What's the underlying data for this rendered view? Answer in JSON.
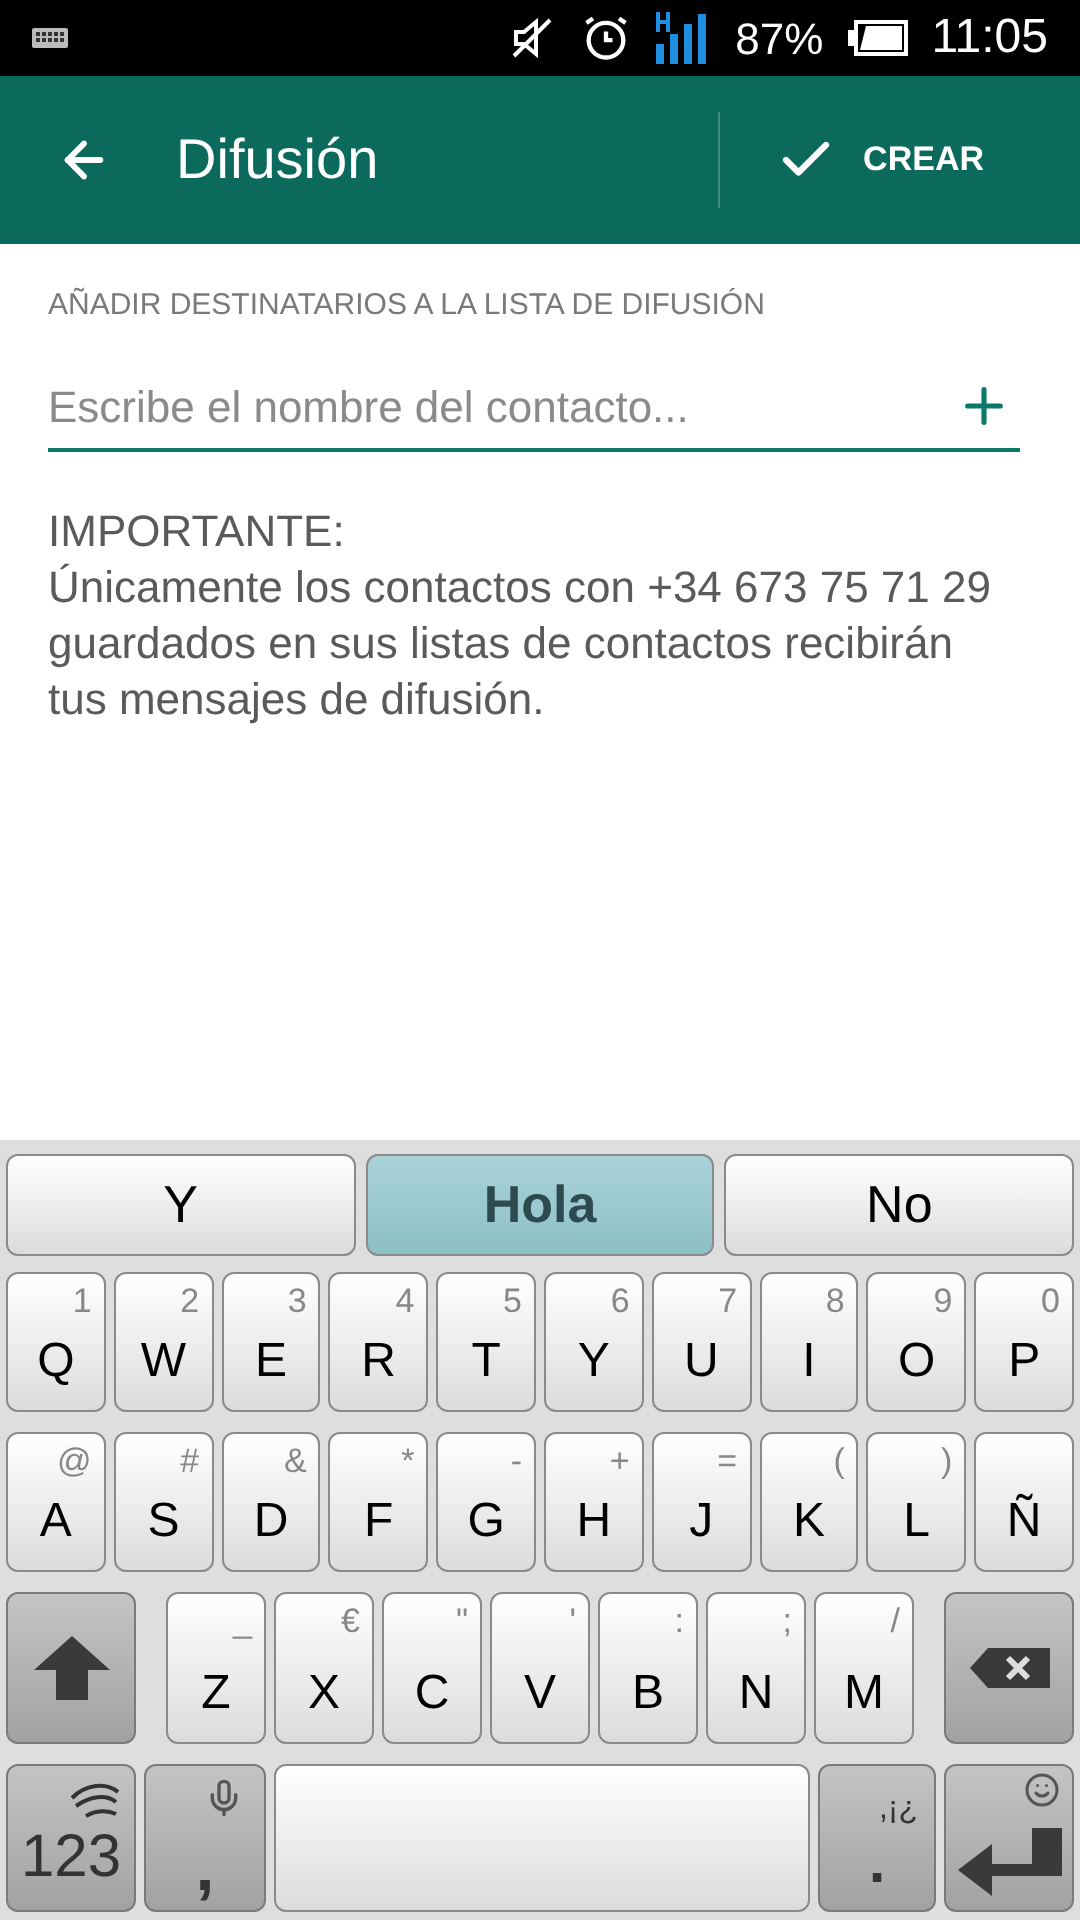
{
  "status_bar": {
    "battery": "87%",
    "time": "11:05"
  },
  "app_bar": {
    "title": "Difusión",
    "action": "CREAR"
  },
  "section_label": "AÑADIR DESTINATARIOS A LA LISTA DE DIFUSIÓN",
  "recipient_field": {
    "placeholder": "Escribe el nombre del contacto..."
  },
  "note": {
    "heading": "IMPORTANTE:",
    "body": "Únicamente los contactos con +34 673 75 71 29 guardados en sus listas de contactos recibirán tus mensajes de difusión."
  },
  "keyboard": {
    "suggestions": [
      {
        "label": "Y",
        "selected": false
      },
      {
        "label": "Hola",
        "selected": true
      },
      {
        "label": "No",
        "selected": false
      }
    ],
    "rows": [
      [
        {
          "kind": "letter",
          "main": "Q",
          "alt": "1"
        },
        {
          "kind": "letter",
          "main": "W",
          "alt": "2"
        },
        {
          "kind": "letter",
          "main": "E",
          "alt": "3"
        },
        {
          "kind": "letter",
          "main": "R",
          "alt": "4"
        },
        {
          "kind": "letter",
          "main": "T",
          "alt": "5"
        },
        {
          "kind": "letter",
          "main": "Y",
          "alt": "6"
        },
        {
          "kind": "letter",
          "main": "U",
          "alt": "7"
        },
        {
          "kind": "letter",
          "main": "I",
          "alt": "8"
        },
        {
          "kind": "letter",
          "main": "O",
          "alt": "9"
        },
        {
          "kind": "letter",
          "main": "P",
          "alt": "0"
        }
      ],
      [
        {
          "kind": "letter",
          "main": "A",
          "alt": "@"
        },
        {
          "kind": "letter",
          "main": "S",
          "alt": "#"
        },
        {
          "kind": "letter",
          "main": "D",
          "alt": "&"
        },
        {
          "kind": "letter",
          "main": "F",
          "alt": "*"
        },
        {
          "kind": "letter",
          "main": "G",
          "alt": "-"
        },
        {
          "kind": "letter",
          "main": "H",
          "alt": "+"
        },
        {
          "kind": "letter",
          "main": "J",
          "alt": "="
        },
        {
          "kind": "letter",
          "main": "K",
          "alt": "("
        },
        {
          "kind": "letter",
          "main": "L",
          "alt": ")"
        },
        {
          "kind": "letter",
          "main": "Ñ"
        }
      ],
      [
        {
          "kind": "shift"
        },
        {
          "kind": "letter",
          "main": "Z",
          "alt": "_"
        },
        {
          "kind": "letter",
          "main": "X",
          "alt": "€"
        },
        {
          "kind": "letter",
          "main": "C",
          "alt": "\""
        },
        {
          "kind": "letter",
          "main": "V",
          "alt": "'"
        },
        {
          "kind": "letter",
          "main": "B",
          "alt": ":"
        },
        {
          "kind": "letter",
          "main": "N",
          "alt": ";"
        },
        {
          "kind": "letter",
          "main": "M",
          "alt": "/"
        },
        {
          "kind": "backspace"
        }
      ],
      [
        {
          "kind": "numbers",
          "main": "123"
        },
        {
          "kind": "comma",
          "main": ","
        },
        {
          "kind": "space"
        },
        {
          "kind": "period",
          "main": ".",
          "alt": ",¡¿"
        },
        {
          "kind": "enter"
        }
      ]
    ]
  }
}
